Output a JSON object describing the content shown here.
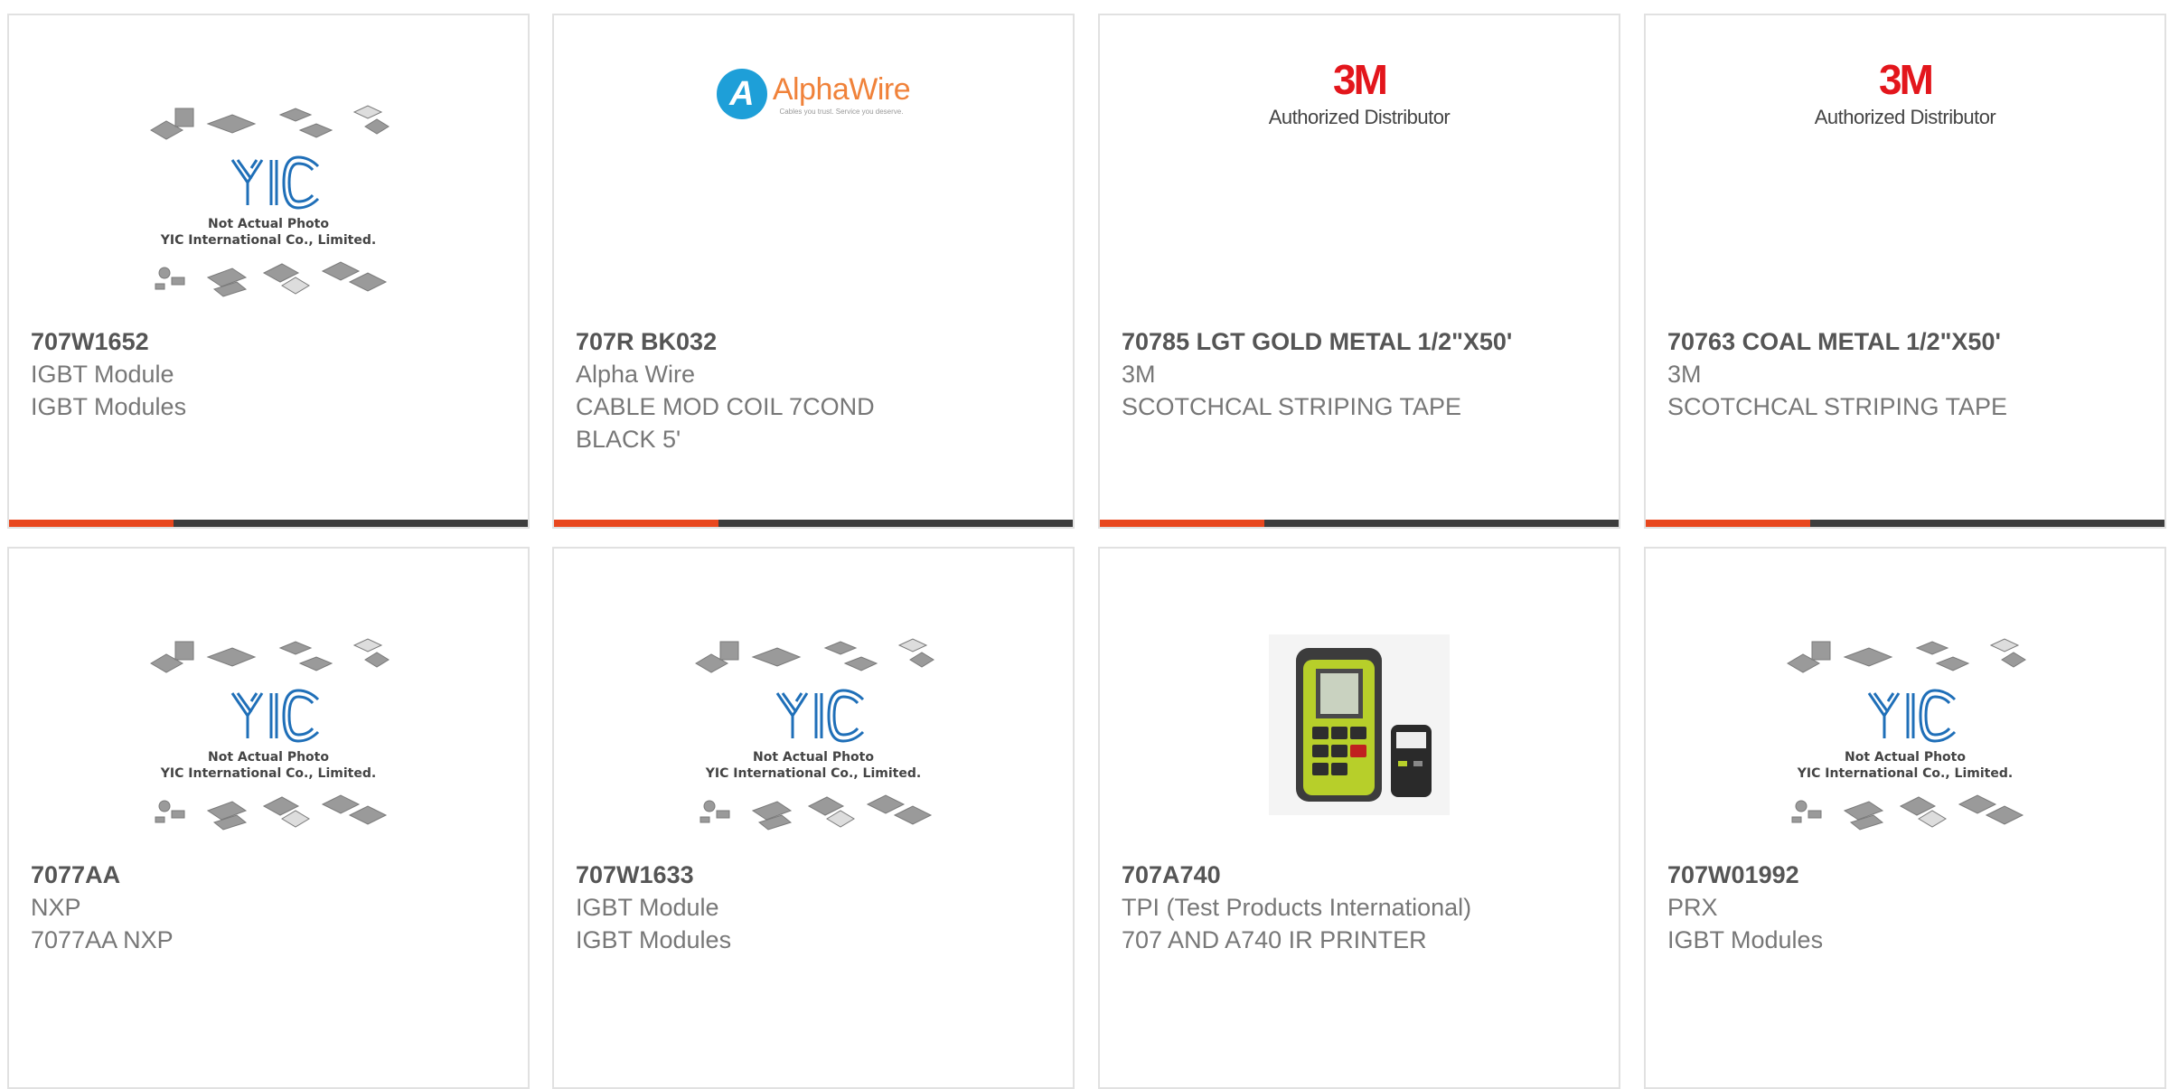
{
  "products": [
    {
      "part": "707W1652",
      "line1": "IGBT Module",
      "line2": "IGBT Modules",
      "line3": "",
      "image": "yic-placeholder"
    },
    {
      "part": "707R BK032",
      "line1": "Alpha Wire",
      "line2": "CABLE MOD COIL 7COND",
      "line3": "BLACK 5'",
      "image": "alpha-wire-logo"
    },
    {
      "part": "70785 LGT GOLD METAL 1/2\"X50'",
      "line1": "3M",
      "line2": "SCOTCHCAL STRIPING TAPE",
      "line3": "",
      "image": "3m-logo"
    },
    {
      "part": "70763 COAL METAL 1/2\"X50'",
      "line1": "3M",
      "line2": "SCOTCHCAL STRIPING TAPE",
      "line3": "",
      "image": "3m-logo"
    },
    {
      "part": "7077AA",
      "line1": "NXP",
      "line2": "7077AA NXP",
      "line3": "",
      "image": "yic-placeholder"
    },
    {
      "part": "707W1633",
      "line1": "IGBT Module",
      "line2": "IGBT Modules",
      "line3": "",
      "image": "yic-placeholder"
    },
    {
      "part": "707A740",
      "line1": "TPI (Test Products International)",
      "line2": "707 AND A740 IR PRINTER",
      "line3": "",
      "image": "device-photo"
    },
    {
      "part": "707W01992",
      "line1": "PRX",
      "line2": "IGBT Modules",
      "line3": "",
      "image": "yic-placeholder"
    }
  ],
  "yic": {
    "brand": "YIC",
    "note1": "Not Actual Photo",
    "note2": "YIC International Co., Limited."
  },
  "alpha": {
    "mark": "A",
    "name": "AlphaWire",
    "tagline": "Cables you trust. Service you deserve."
  },
  "mmm": {
    "logo": "3M",
    "sub": "Authorized Distributor"
  },
  "colors": {
    "accent": "#e8471e",
    "bar": "#3d3d3d",
    "border": "#e1e1e1",
    "yic_blue": "#1f6fb8",
    "alpha_blue": "#1e9fd8",
    "alpha_orange": "#f0823a",
    "mmm_red": "#e3161c"
  }
}
